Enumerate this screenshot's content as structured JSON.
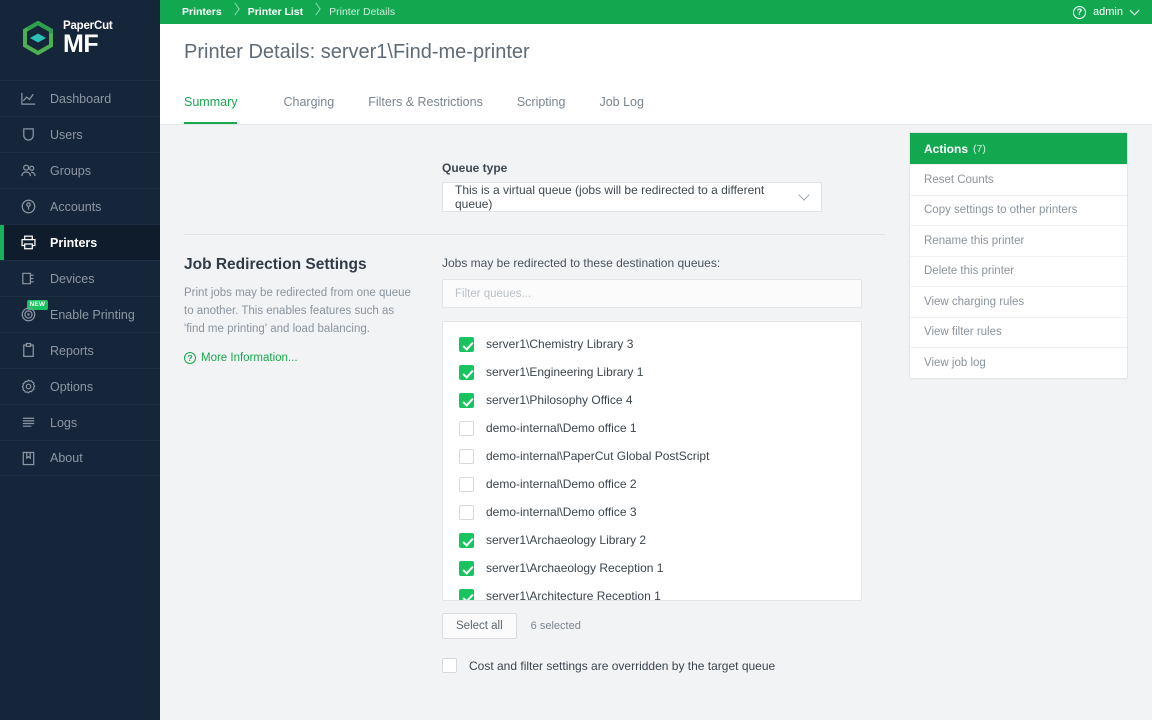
{
  "brand": {
    "name_top": "PaperCut",
    "name_bottom": "MF",
    "logo_icon": "papercut-hexagon-logo",
    "accent_green": "#12a850",
    "check_green": "#19c45f",
    "sidebar_bg": "#16263a"
  },
  "sidebar": {
    "items": [
      {
        "label": "Dashboard",
        "icon": "chart-line-icon",
        "active": false,
        "badge": null
      },
      {
        "label": "Users",
        "icon": "shield-icon",
        "active": false,
        "badge": null
      },
      {
        "label": "Groups",
        "icon": "people-icon",
        "active": false,
        "badge": null
      },
      {
        "label": "Accounts",
        "icon": "coin-icon",
        "active": false,
        "badge": null
      },
      {
        "label": "Printers",
        "icon": "printer-icon",
        "active": true,
        "badge": null
      },
      {
        "label": "Devices",
        "icon": "device-icon",
        "active": false,
        "badge": null
      },
      {
        "label": "Enable Printing",
        "icon": "target-icon",
        "active": false,
        "badge": "NEW"
      },
      {
        "label": "Reports",
        "icon": "clipboard-icon",
        "active": false,
        "badge": null
      },
      {
        "label": "Options",
        "icon": "gear-icon",
        "active": false,
        "badge": null
      },
      {
        "label": "Logs",
        "icon": "lines-icon",
        "active": false,
        "badge": null
      },
      {
        "label": "About",
        "icon": "book-icon",
        "active": false,
        "badge": null
      }
    ]
  },
  "topbar": {
    "breadcrumbs": [
      "Printers",
      "Printer List",
      "Printer Details"
    ],
    "help_icon": "help-circle-icon",
    "user": "admin",
    "user_caret": "chevron-down-icon"
  },
  "page": {
    "title": "Printer Details: server1\\Find-me-printer"
  },
  "tabs": [
    {
      "label": "Summary",
      "active": true
    },
    {
      "label": "Charging",
      "active": false
    },
    {
      "label": "Filters & Restrictions",
      "active": false
    },
    {
      "label": "Scripting",
      "active": false
    },
    {
      "label": "Job Log",
      "active": false
    }
  ],
  "queue_type": {
    "label": "Queue type",
    "value": "This is a virtual queue (jobs will be redirected to a different queue)",
    "caret": "chevron-down-icon"
  },
  "redirection": {
    "title": "Job Redirection Settings",
    "description": "Print jobs may be redirected from one queue to another. This enables features such as 'find me printing' and load balancing.",
    "more_info": "More Information...",
    "more_info_icon": "help-circle-icon",
    "list_label": "Jobs may be redirected to these destination queues:",
    "filter_placeholder": "Filter queues...",
    "filter_value": "",
    "queues": [
      {
        "name": "server1\\Chemistry Library 3",
        "checked": true
      },
      {
        "name": "server1\\Engineering Library 1",
        "checked": true
      },
      {
        "name": "server1\\Philosophy Office 4",
        "checked": true
      },
      {
        "name": "demo-internal\\Demo office 1",
        "checked": false
      },
      {
        "name": "demo-internal\\PaperCut Global PostScript",
        "checked": false
      },
      {
        "name": "demo-internal\\Demo office 2",
        "checked": false
      },
      {
        "name": "demo-internal\\Demo office 3",
        "checked": false
      },
      {
        "name": "server1\\Archaeology Library 2",
        "checked": true
      },
      {
        "name": "server1\\Archaeology Reception 1",
        "checked": true
      },
      {
        "name": "server1\\Architecture Reception 1",
        "checked": true
      }
    ],
    "select_all_label": "Select all",
    "selected_count": "6 selected",
    "override_label": "Cost and filter settings are overridden by the target queue",
    "override_checked": false
  },
  "actions": {
    "title": "Actions",
    "count": "(7)",
    "items": [
      "Reset Counts",
      "Copy settings to other printers",
      "Rename this printer",
      "Delete this printer",
      "View charging rules",
      "View filter rules",
      "View job log"
    ]
  }
}
